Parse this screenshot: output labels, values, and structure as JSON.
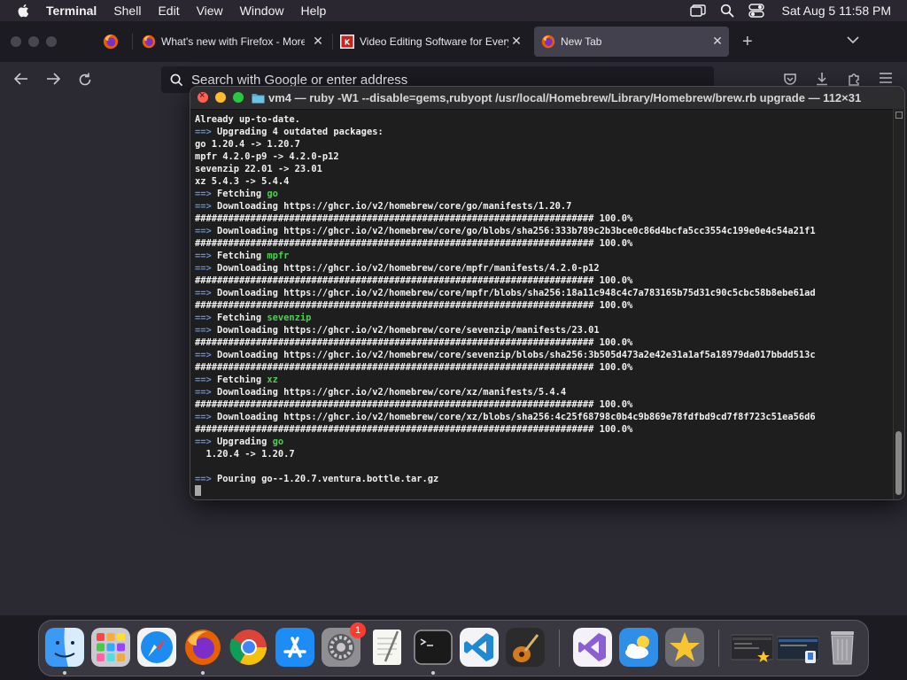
{
  "menubar": {
    "app": "Terminal",
    "items": [
      "Shell",
      "Edit",
      "View",
      "Window",
      "Help"
    ],
    "clock": "Sat Aug 5  11:58 PM",
    "icons": [
      "apple-icon",
      "screen-mirroring-icon",
      "spotlight-search-icon",
      "control-center-icon"
    ]
  },
  "firefox": {
    "tabs": [
      {
        "label": "What's new with Firefox - More ",
        "icon": "firefox-icon"
      },
      {
        "label": "Video Editing Software for Every",
        "icon": "site-favicon"
      },
      {
        "label": "New Tab",
        "icon": "firefox-icon"
      }
    ],
    "url_placeholder": "Search with Google or enter address"
  },
  "terminal": {
    "title": "vm4 — ruby -W1 --disable=gems,rubyopt /usr/local/Homebrew/Library/Homebrew/brew.rb upgrade — 112×31",
    "lines": [
      {
        "a": "",
        "t": "Already up-to-date.",
        "g": ""
      },
      {
        "a": "==>",
        "t": " Upgrading 4 outdated packages:",
        "g": ""
      },
      {
        "a": "",
        "t": "go 1.20.4 -> 1.20.7",
        "g": ""
      },
      {
        "a": "",
        "t": "mpfr 4.2.0-p9 -> 4.2.0-p12",
        "g": ""
      },
      {
        "a": "",
        "t": "sevenzip 22.01 -> 23.01",
        "g": ""
      },
      {
        "a": "",
        "t": "xz 5.4.3 -> 5.4.4",
        "g": ""
      },
      {
        "a": "==>",
        "t": " Fetching ",
        "g": "go"
      },
      {
        "a": "==>",
        "t": " Downloading https://ghcr.io/v2/homebrew/core/go/manifests/1.20.7",
        "g": ""
      },
      {
        "a": "",
        "t": "######################################################################## 100.0%",
        "g": ""
      },
      {
        "a": "==>",
        "t": " Downloading https://ghcr.io/v2/homebrew/core/go/blobs/sha256:333b789c2b3bce0c86d4bcfa5cc3554c199e0e4c54a21f1",
        "g": ""
      },
      {
        "a": "",
        "t": "######################################################################## 100.0%",
        "g": ""
      },
      {
        "a": "==>",
        "t": " Fetching ",
        "g": "mpfr"
      },
      {
        "a": "==>",
        "t": " Downloading https://ghcr.io/v2/homebrew/core/mpfr/manifests/4.2.0-p12",
        "g": ""
      },
      {
        "a": "",
        "t": "######################################################################## 100.0%",
        "g": ""
      },
      {
        "a": "==>",
        "t": " Downloading https://ghcr.io/v2/homebrew/core/mpfr/blobs/sha256:18a11c948c4c7a783165b75d31c90c5cbc58b8ebe61ad",
        "g": ""
      },
      {
        "a": "",
        "t": "######################################################################## 100.0%",
        "g": ""
      },
      {
        "a": "==>",
        "t": " Fetching ",
        "g": "sevenzip"
      },
      {
        "a": "==>",
        "t": " Downloading https://ghcr.io/v2/homebrew/core/sevenzip/manifests/23.01",
        "g": ""
      },
      {
        "a": "",
        "t": "######################################################################## 100.0%",
        "g": ""
      },
      {
        "a": "==>",
        "t": " Downloading https://ghcr.io/v2/homebrew/core/sevenzip/blobs/sha256:3b505d473a2e42e31a1af5a18979da017bbdd513c",
        "g": ""
      },
      {
        "a": "",
        "t": "######################################################################## 100.0%",
        "g": ""
      },
      {
        "a": "==>",
        "t": " Fetching ",
        "g": "xz"
      },
      {
        "a": "==>",
        "t": " Downloading https://ghcr.io/v2/homebrew/core/xz/manifests/5.4.4",
        "g": ""
      },
      {
        "a": "",
        "t": "######################################################################## 100.0%",
        "g": ""
      },
      {
        "a": "==>",
        "t": " Downloading https://ghcr.io/v2/homebrew/core/xz/blobs/sha256:4c25f68798c0b4c9b869e78fdfbd9cd7f8f723c51ea56d6",
        "g": ""
      },
      {
        "a": "",
        "t": "######################################################################## 100.0%",
        "g": ""
      },
      {
        "a": "==>",
        "t": " Upgrading ",
        "g": "go"
      },
      {
        "a": "",
        "t": "  1.20.4 -> 1.20.7",
        "g": ""
      },
      {
        "a": "",
        "t": "",
        "g": ""
      },
      {
        "a": "==>",
        "t": " Pouring go--1.20.7.ventura.bottle.tar.gz",
        "g": ""
      }
    ]
  },
  "dock": {
    "apps": [
      {
        "name": "finder-icon",
        "running": true
      },
      {
        "name": "launchpad-icon",
        "running": false
      },
      {
        "name": "safari-icon",
        "running": false
      },
      {
        "name": "firefox-icon",
        "running": true
      },
      {
        "name": "chrome-icon",
        "running": false
      },
      {
        "name": "app-store-icon",
        "running": false
      },
      {
        "name": "system-settings-icon",
        "running": false
      },
      {
        "name": "textedit-icon",
        "running": false
      },
      {
        "name": "terminal-icon",
        "running": true
      },
      {
        "name": "vscode-icon",
        "running": false
      },
      {
        "name": "garageband-icon",
        "running": false
      },
      {
        "name": "visual-studio-icon",
        "running": false
      },
      {
        "name": "weather-icon",
        "running": false
      },
      {
        "name": "imovie-icon",
        "running": false
      }
    ],
    "settings_badge": "1",
    "colors": {
      "accent": "#5b8cf0",
      "green_text": "#4fcf4f",
      "badge": "#ff3b30"
    }
  }
}
